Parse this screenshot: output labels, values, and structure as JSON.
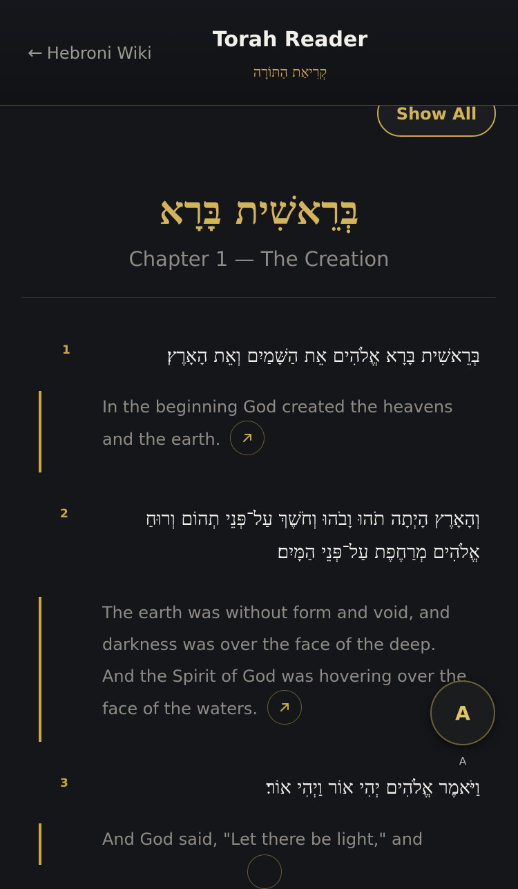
{
  "header": {
    "back_label": "Hebroni Wiki",
    "back_arrow": "←",
    "title": "Torah Reader",
    "subtitle": "קְרִיאַת הַתּוֹרָה"
  },
  "toolbar": {
    "show_all_label": "Show All"
  },
  "book": {
    "title": "בְּרֵאשִׁית בָּרָא",
    "chapter_title": "Chapter 1 — The Creation"
  },
  "verses": [
    {
      "number": "1",
      "hebrew": "בְּרֵאשִׁית בָּרָא אֱלֹהִים אֵת הַשָּׁמַיִם וְאֵת הָאָרֶץ׃",
      "translation": "In the beginning God created the heavens and the earth."
    },
    {
      "number": "2",
      "hebrew": "וְהָאָרֶץ הָיְתָה תֹהוּ וָבֹהוּ וְחֹשֶׁךְ עַל־פְּנֵי תְהוֹם וְרוּחַ אֱלֹהִים מְרַחֶפֶת עַל־פְּנֵי הַמָּיִם׃",
      "translation": "The earth was without form and void, and darkness was over the face of the deep. And the Spirit of God was hovering over the face of the waters."
    },
    {
      "number": "3",
      "hebrew": "וַיֹּאמֶר אֱלֹהִים יְהִי אוֹר וַיְהִי אוֹר׃",
      "translation": "And God said, \"Let there be light,\" and"
    }
  ],
  "fab": {
    "label": "A",
    "caption": "A"
  },
  "icons": {
    "back": "arrow-left-icon",
    "open": "arrow-up-right-icon"
  },
  "colors": {
    "background": "#15161a",
    "accent": "#c9a84c",
    "text": "#f2f0ea",
    "muted": "#8e8b85"
  }
}
